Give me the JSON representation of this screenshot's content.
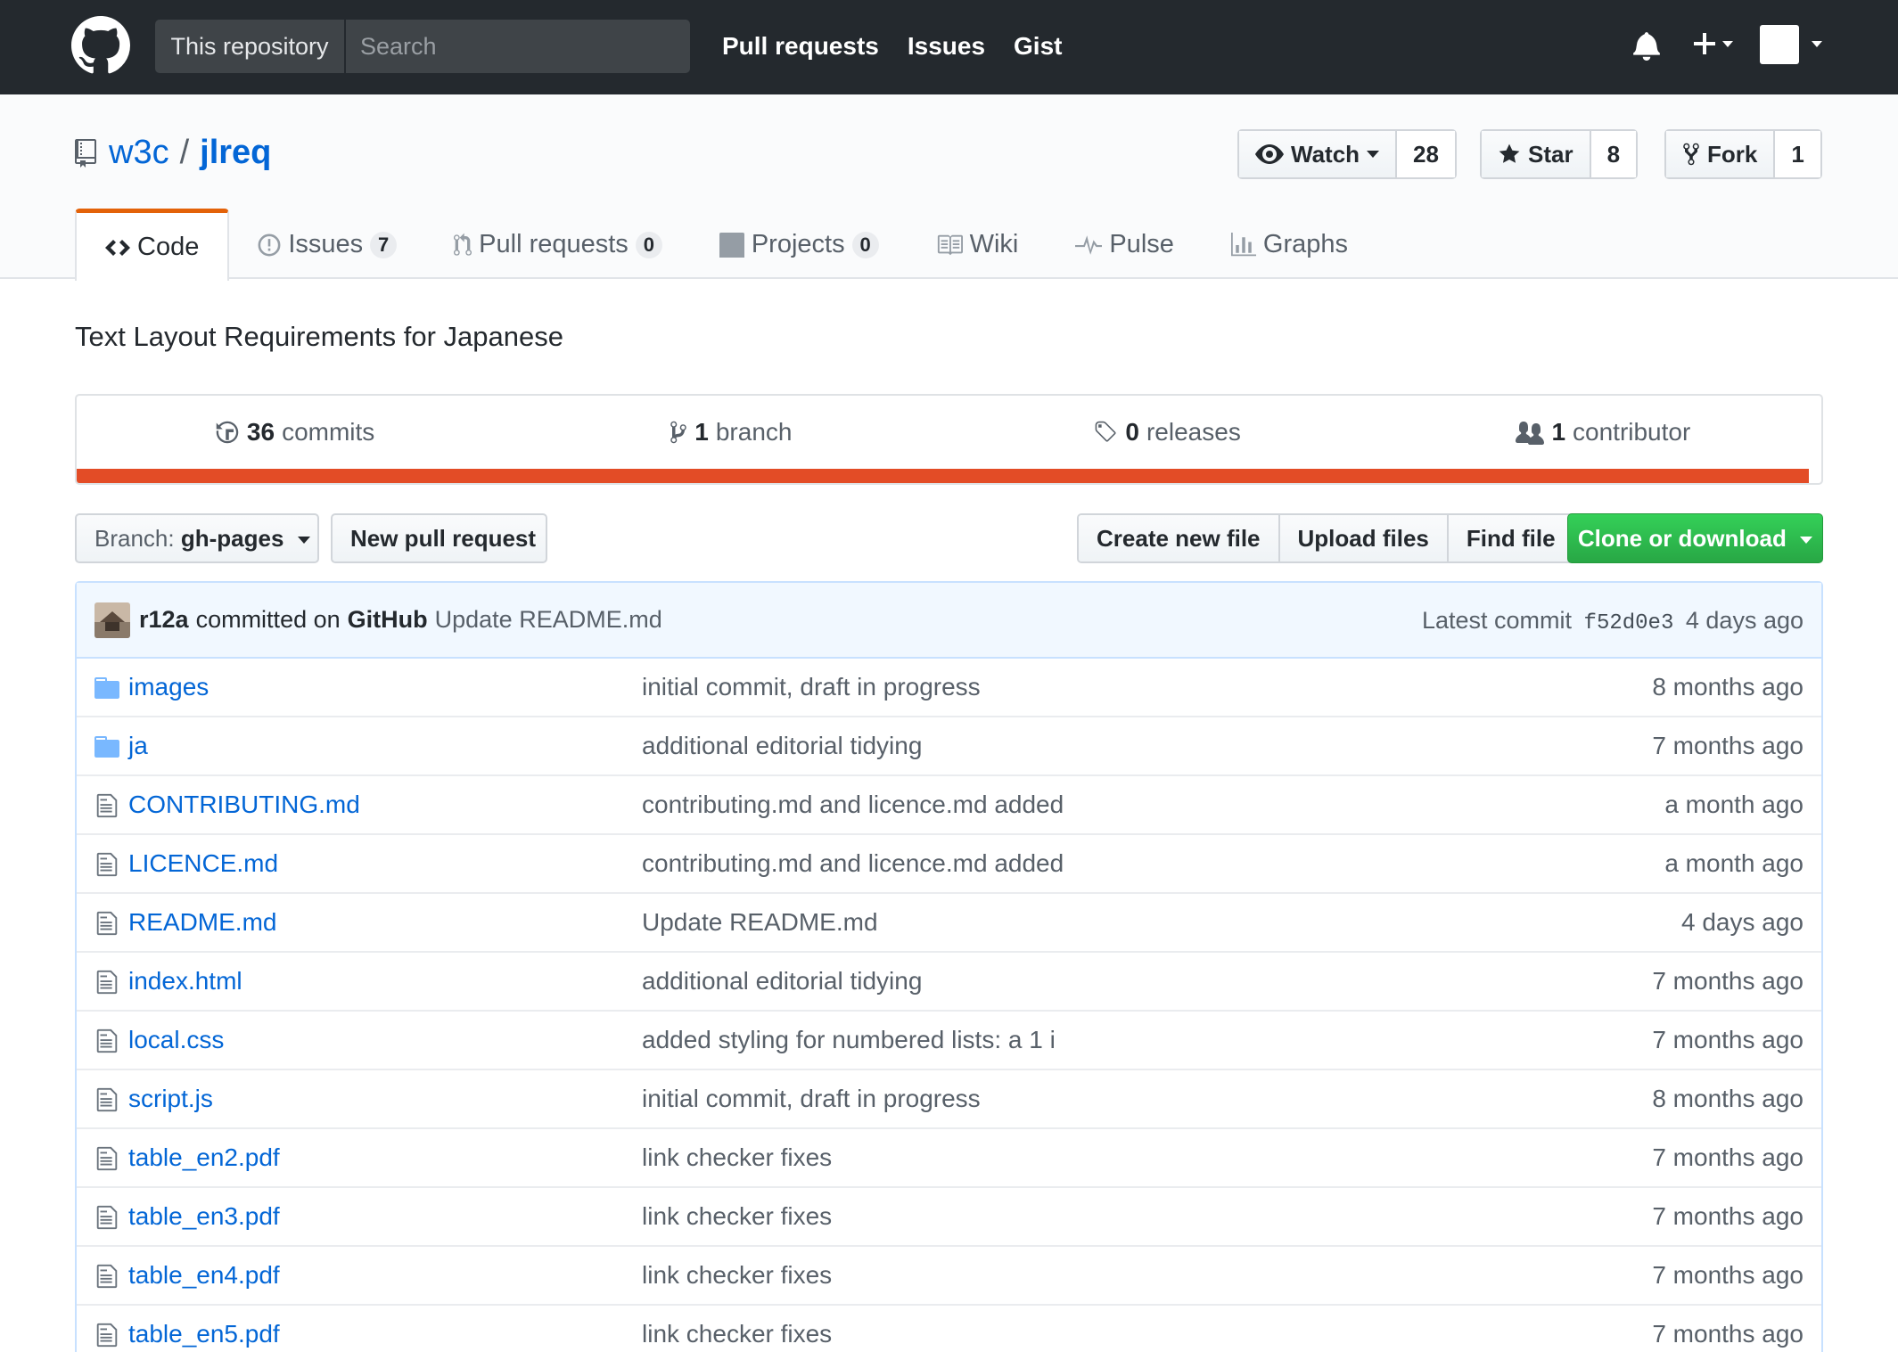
{
  "header": {
    "search_scope": "This repository",
    "search_placeholder": "Search",
    "nav": [
      "Pull requests",
      "Issues",
      "Gist"
    ]
  },
  "repo": {
    "owner": "w3c",
    "separator": "/",
    "name": "jlreq",
    "watch_label": "Watch",
    "watch_count": "28",
    "star_label": "Star",
    "star_count": "8",
    "fork_label": "Fork",
    "fork_count": "1"
  },
  "tabs": [
    {
      "label": "Code",
      "count": null,
      "icon": "code-icon"
    },
    {
      "label": "Issues",
      "count": "7",
      "icon": "issue-icon"
    },
    {
      "label": "Pull requests",
      "count": "0",
      "icon": "pull-request-icon"
    },
    {
      "label": "Projects",
      "count": "0",
      "icon": "project-icon"
    },
    {
      "label": "Wiki",
      "count": null,
      "icon": "book-icon"
    },
    {
      "label": "Pulse",
      "count": null,
      "icon": "pulse-icon"
    },
    {
      "label": "Graphs",
      "count": null,
      "icon": "graph-icon"
    }
  ],
  "description": "Text Layout Requirements for Japanese",
  "summary": {
    "commits_num": "36",
    "commits_label": "commits",
    "branch_num": "1",
    "branch_label": "branch",
    "releases_num": "0",
    "releases_label": "releases",
    "contributors_num": "1",
    "contributors_label": "contributor",
    "language_color": "#e34c26"
  },
  "toolbar": {
    "branch_prefix": "Branch:",
    "branch_name": "gh-pages",
    "new_pr": "New pull request",
    "create_file": "Create new file",
    "upload_files": "Upload files",
    "find_file": "Find file",
    "clone": "Clone or download"
  },
  "commit": {
    "author": "r12a",
    "committed_on": "committed on",
    "committer": "GitHub",
    "message": "Update README.md",
    "latest_label": "Latest commit",
    "sha": "f52d0e3",
    "age": "4 days ago"
  },
  "files": [
    {
      "type": "dir",
      "name": "images",
      "message": "initial commit, draft in progress",
      "age": "8 months ago"
    },
    {
      "type": "dir",
      "name": "ja",
      "message": "additional editorial tidying",
      "age": "7 months ago"
    },
    {
      "type": "file",
      "name": "CONTRIBUTING.md",
      "message": "contributing.md and licence.md added",
      "age": "a month ago"
    },
    {
      "type": "file",
      "name": "LICENCE.md",
      "message": "contributing.md and licence.md added",
      "age": "a month ago"
    },
    {
      "type": "file",
      "name": "README.md",
      "message": "Update README.md",
      "age": "4 days ago"
    },
    {
      "type": "file",
      "name": "index.html",
      "message": "additional editorial tidying",
      "age": "7 months ago"
    },
    {
      "type": "file",
      "name": "local.css",
      "message": "added styling for numbered lists: a 1 i",
      "age": "7 months ago"
    },
    {
      "type": "file",
      "name": "script.js",
      "message": "initial commit, draft in progress",
      "age": "8 months ago"
    },
    {
      "type": "file",
      "name": "table_en2.pdf",
      "message": "link checker fixes",
      "age": "7 months ago"
    },
    {
      "type": "file",
      "name": "table_en3.pdf",
      "message": "link checker fixes",
      "age": "7 months ago"
    },
    {
      "type": "file",
      "name": "table_en4.pdf",
      "message": "link checker fixes",
      "age": "7 months ago"
    },
    {
      "type": "file",
      "name": "table_en5.pdf",
      "message": "link checker fixes",
      "age": "7 months ago"
    }
  ]
}
